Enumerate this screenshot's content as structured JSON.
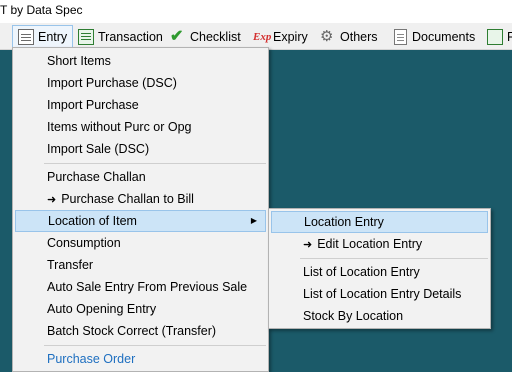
{
  "window": {
    "title": "T by Data Spec"
  },
  "menubar": {
    "items": [
      {
        "label": "Entry",
        "icon": "entry-icon"
      },
      {
        "label": "Transaction",
        "icon": "transaction-icon"
      },
      {
        "label": "Checklist",
        "icon": "checkmark-icon"
      },
      {
        "label": "Expiry",
        "icon": "expiry-icon",
        "icon_text": "Exp"
      },
      {
        "label": "Others",
        "icon": "gears-icon"
      },
      {
        "label": "Documents",
        "icon": "document-icon"
      },
      {
        "label": "R",
        "icon": "report-icon"
      }
    ]
  },
  "entry_menu": {
    "items": [
      {
        "label": "Short Items"
      },
      {
        "label": "Import Purchase (DSC)"
      },
      {
        "label": "Import Purchase"
      },
      {
        "label": "Items without Purc or Opg"
      },
      {
        "label": "Import Sale (DSC)"
      },
      {
        "label": "Purchase Challan"
      },
      {
        "label": "Purchase Challan to Bill",
        "prefix": "➜"
      },
      {
        "label": "Location of Item",
        "has_submenu": true,
        "highlighted": true
      },
      {
        "label": "Consumption"
      },
      {
        "label": "Transfer"
      },
      {
        "label": "Auto Sale Entry From Previous Sale"
      },
      {
        "label": "Auto Opening Entry"
      },
      {
        "label": "Batch Stock Correct (Transfer)"
      },
      {
        "label": "Purchase Order"
      }
    ]
  },
  "location_submenu": {
    "items": [
      {
        "label": "Location Entry",
        "highlighted": true
      },
      {
        "label": "Edit Location Entry",
        "prefix": "➜"
      },
      {
        "label": "List of Location Entry"
      },
      {
        "label": "List of Location Entry Details"
      },
      {
        "label": "Stock By Location"
      }
    ]
  },
  "colors": {
    "desktop_bg": "#1b5a69",
    "highlight_bg": "#cce4f7",
    "highlight_border": "#99c4ea",
    "link_text": "#1e6fc0"
  }
}
